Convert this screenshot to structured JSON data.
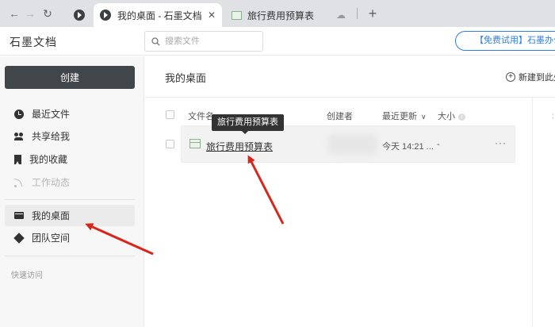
{
  "browser": {
    "tabs": [
      {
        "title": "我的桌面 - 石墨文档",
        "close": "✕",
        "active": true
      },
      {
        "title": "旅行费用预算表",
        "active": false
      }
    ],
    "new_tab": "+",
    "back": "←",
    "forward": "→",
    "reload": "↻"
  },
  "app": {
    "logo": "石墨文档",
    "search_placeholder": "搜索文件",
    "promo": "【免费试用】石墨办公"
  },
  "sidebar": {
    "create_label": "创建",
    "items": [
      {
        "label": "最近文件",
        "icon": "clock-icon"
      },
      {
        "label": "共享给我",
        "icon": "people-icon"
      },
      {
        "label": "我的收藏",
        "icon": "bookmark-icon"
      },
      {
        "label": "工作动态",
        "icon": "rss-icon",
        "disabled": true
      },
      {
        "label": "我的桌面",
        "icon": "desktop-icon",
        "selected": true
      },
      {
        "label": "团队空间",
        "icon": "team-icon"
      }
    ],
    "quick_access": "快速访问"
  },
  "main": {
    "title": "我的桌面",
    "new_button": "新建到此处",
    "columns": {
      "name": "文件名",
      "creator": "创建者",
      "updated": "最近更新",
      "sort_arrow": "∨",
      "size": "大小",
      "size_info": "i"
    },
    "files": [
      {
        "name": "旅行费用预算表",
        "updated": "今天 14:21 ...",
        "size": "-",
        "more": "···"
      }
    ],
    "tooltip": "旅行费用预算表"
  },
  "colors": {
    "annotation_arrow": "#d9261c",
    "create_button": "#41464b",
    "promo_accent": "#2f7ef0"
  }
}
